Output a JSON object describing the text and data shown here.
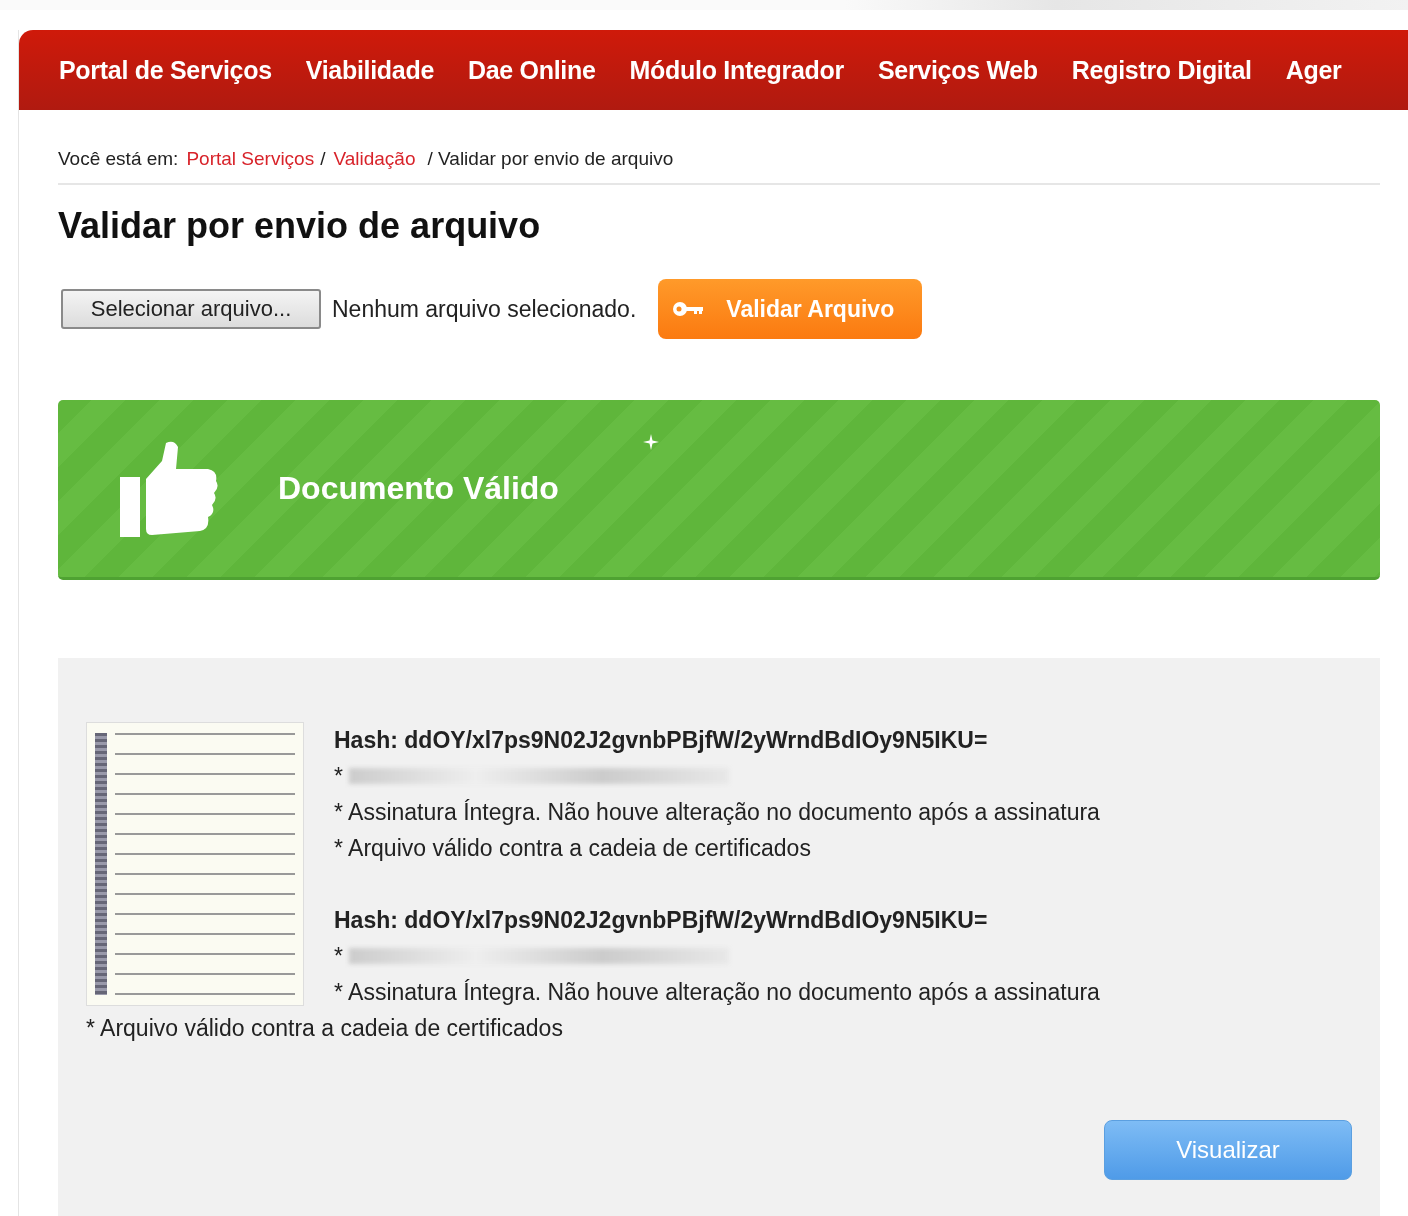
{
  "nav": {
    "items": [
      "Portal de Serviços",
      "Viabilidade",
      "Dae Online",
      "Módulo Integrador",
      "Serviços Web",
      "Registro Digital",
      "Ager"
    ]
  },
  "breadcrumb": {
    "prefix": "Você está em:",
    "links": [
      "Portal Serviços",
      "Validação"
    ],
    "current": "/ Validar por envio de arquivo",
    "separator": "/"
  },
  "title": "Validar por envio de arquivo",
  "upload": {
    "button": "Selecionar arquivo...",
    "status": "Nenhum arquivo selecionado.",
    "submit": "Validar Arquivo"
  },
  "banner": {
    "text": "Documento Válido"
  },
  "signatures": [
    {
      "hash": "Hash: ddOY/xl7ps9N02J2gvnbPBjfW/2yWrndBdIOy9N5IKU=",
      "signer": "*",
      "lines": [
        "* Assinatura Íntegra. Não houve alteração no documento após a assinatura",
        "* Arquivo válido contra a cadeia de certificados"
      ]
    },
    {
      "hash": "Hash: ddOY/xl7ps9N02J2gvnbPBjfW/2yWrndBdIOy9N5IKU=",
      "signer": "*",
      "lines": [
        "* Assinatura Íntegra. Não houve alteração no documento após a assinatura",
        "* Arquivo válido contra a cadeia de certificados"
      ]
    }
  ],
  "view_button": "Visualizar"
}
